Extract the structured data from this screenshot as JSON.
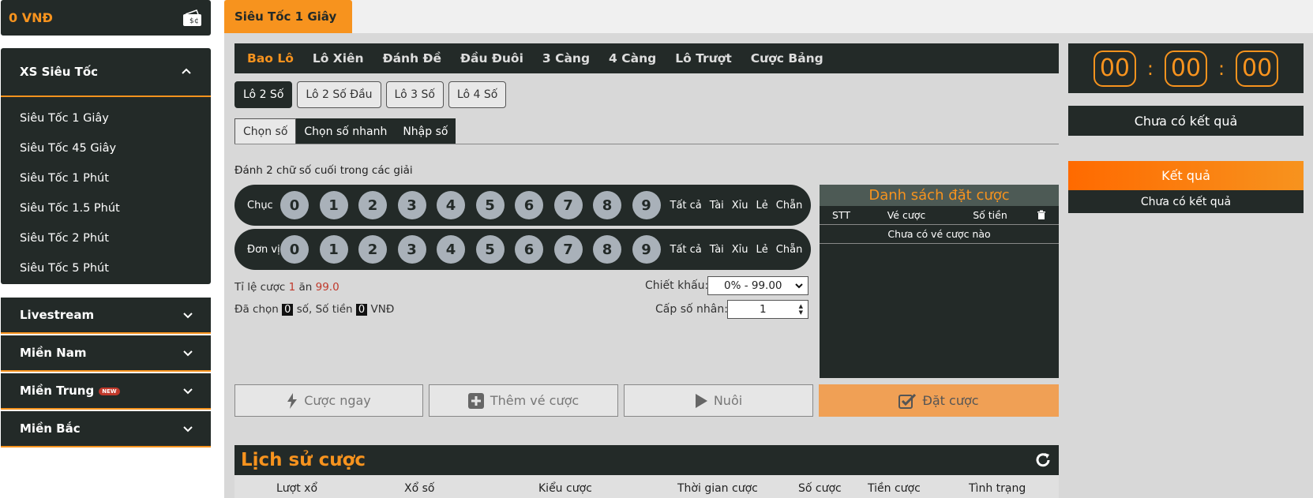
{
  "balance": "0 VNĐ",
  "sidebar": {
    "header": "XS Siêu Tốc",
    "items": [
      {
        "label": "Siêu Tốc 1 Giây"
      },
      {
        "label": "Siêu Tốc 45 Giây"
      },
      {
        "label": "Siêu Tốc 1 Phút"
      },
      {
        "label": "Siêu Tốc 1.5 Phút"
      },
      {
        "label": "Siêu Tốc 2 Phút"
      },
      {
        "label": "Siêu Tốc 5 Phút"
      }
    ],
    "groups": [
      {
        "label": "Livestream",
        "badge": ""
      },
      {
        "label": "Miền Nam",
        "badge": ""
      },
      {
        "label": "Miền Trung",
        "badge": "NEW"
      },
      {
        "label": "Miền Bắc",
        "badge": ""
      }
    ]
  },
  "top_tab": "Siêu Tốc 1 Giây",
  "bet_types": [
    "Bao Lô",
    "Lô Xiên",
    "Đánh Đề",
    "Đầu Đuôi",
    "3 Càng",
    "4 Càng",
    "Lô Trượt",
    "Cược Bảng"
  ],
  "subtabs": [
    "Lô 2 Số",
    "Lô 2 Số Đầu",
    "Lô 3 Số",
    "Lô 4 Số"
  ],
  "modes": [
    "Chọn số",
    "Chọn số nhanh",
    "Nhập số"
  ],
  "hint": "Đánh 2 chữ số cuối trong các giải",
  "rows": [
    {
      "label": "Chục"
    },
    {
      "label": "Đơn vị"
    }
  ],
  "numbers": [
    "0",
    "1",
    "2",
    "3",
    "4",
    "5",
    "6",
    "7",
    "8",
    "9"
  ],
  "quick_select": [
    "Tất cả",
    "Tài",
    "Xỉu",
    "Lẻ",
    "Chẵn"
  ],
  "odds": {
    "prefix": "Tỉ lệ cược",
    "bet": "1",
    "mid": "ăn",
    "payout": "99.0"
  },
  "selected": {
    "prefix": "Đã chọn",
    "count": "0",
    "mid": "số, Số tiền",
    "amount": "0",
    "suffix": "VNĐ"
  },
  "discount": {
    "label": "Chiết khấu:",
    "value": "0% - 99.00"
  },
  "multiplier": {
    "label": "Cấp số nhân:",
    "value": "1"
  },
  "bet_list": {
    "title": "Danh sách đặt cược",
    "columns": [
      "STT",
      "Vé cược",
      "Số tiền"
    ],
    "empty": "Chưa có vé cược nào"
  },
  "buttons": {
    "bet_now": "Cược ngay",
    "add_ticket": "Thêm vé cược",
    "nurture": "Nuôi",
    "place_bet": "Đặt cược"
  },
  "history": {
    "title": "Lịch sử cược",
    "columns": [
      "Lượt xổ",
      "Xổ số",
      "Kiểu cược",
      "Thời gian cược",
      "Số cược",
      "Tiền cược",
      "Tình trạng"
    ]
  },
  "timer": {
    "h": "00",
    "m": "00",
    "s": "00",
    "sep": ":"
  },
  "result_status": "Chưa có kết quả",
  "result": {
    "button": "Kết quả",
    "status": "Chưa có kết quả"
  },
  "colors": {
    "accent": "#f7931e",
    "dark": "#232a28",
    "ball": "#a9b1b9",
    "red": "#c0392b"
  }
}
